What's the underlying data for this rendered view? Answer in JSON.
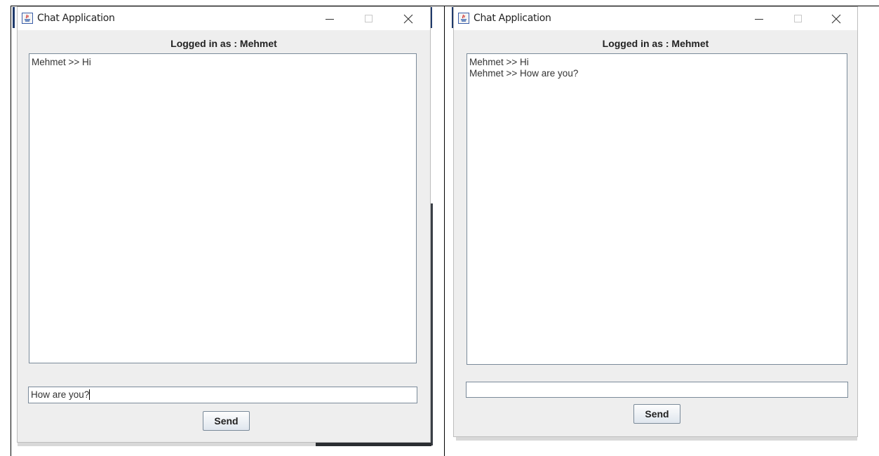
{
  "windows": [
    {
      "title": "Chat Application",
      "logged_in_label": "Logged in as : Mehmet",
      "messages": [
        "Mehmet >> Hi"
      ],
      "input_value": "How are you?",
      "send_label": "Send"
    },
    {
      "title": "Chat Application",
      "logged_in_label": "Logged in as : Mehmet",
      "messages": [
        "Mehmet >> Hi",
        "Mehmet >> How are you?"
      ],
      "input_value": "",
      "send_label": "Send"
    }
  ],
  "icons": {
    "app": "java-icon",
    "minimize": "minimize-icon",
    "maximize": "maximize-icon",
    "close": "close-icon"
  },
  "colors": {
    "window_bg": "#eeeeee",
    "titlebar_bg": "#ffffff",
    "field_border": "#7a8a99",
    "accent_edge": "#1f3a6b"
  }
}
